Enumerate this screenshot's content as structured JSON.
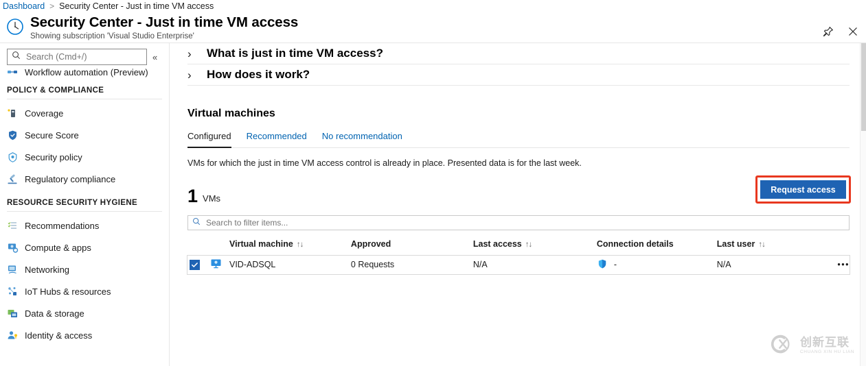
{
  "breadcrumb": {
    "root": "Dashboard",
    "separator": ">",
    "current": "Security Center - Just in time VM access"
  },
  "titlebar": {
    "icon": "clock-icon",
    "title": "Security Center - Just in time VM access",
    "subtitle": "Showing subscription 'Visual Studio Enterprise'",
    "pin_icon": "pin-icon",
    "close_icon": "close-icon"
  },
  "sidebar": {
    "search": {
      "placeholder": "Search (Cmd+/)",
      "value": "",
      "icon": "search-icon"
    },
    "collapse_icon": "chevron-double-left-icon",
    "clipped_item": {
      "label": "Workflow automation (Preview)",
      "icon": "workflow-icon"
    },
    "sections": [
      {
        "title": "POLICY & COMPLIANCE",
        "items": [
          {
            "label": "Coverage",
            "icon": "coverage-icon"
          },
          {
            "label": "Secure Score",
            "icon": "shield-icon"
          },
          {
            "label": "Security policy",
            "icon": "policy-icon"
          },
          {
            "label": "Regulatory compliance",
            "icon": "gavel-icon"
          }
        ]
      },
      {
        "title": "RESOURCE SECURITY HYGIENE",
        "items": [
          {
            "label": "Recommendations",
            "icon": "list-icon"
          },
          {
            "label": "Compute & apps",
            "icon": "compute-icon"
          },
          {
            "label": "Networking",
            "icon": "network-icon"
          },
          {
            "label": "IoT Hubs & resources",
            "icon": "iot-icon"
          },
          {
            "label": "Data & storage",
            "icon": "database-icon"
          },
          {
            "label": "Identity & access",
            "icon": "identity-icon"
          }
        ]
      }
    ]
  },
  "main": {
    "accordions": [
      {
        "label": "What is just in time VM access?",
        "icon": "chevron-right-icon"
      },
      {
        "label": "How does it work?",
        "icon": "chevron-right-icon"
      }
    ],
    "section_title": "Virtual machines",
    "tabs": [
      {
        "label": "Configured",
        "active": true
      },
      {
        "label": "Recommended",
        "active": false
      },
      {
        "label": "No recommendation",
        "active": false
      }
    ],
    "description": "VMs for which the just in time VM access control is already in place. Presented data is for the last week.",
    "count": {
      "number": "1",
      "label": "VMs"
    },
    "request_button": {
      "label": "Request access",
      "highlight_color": "#e8381f",
      "background": "#1f63b3"
    },
    "filter": {
      "placeholder": "Search to filter items...",
      "value": "",
      "icon": "search-icon"
    },
    "table": {
      "columns": [
        {
          "label": "Virtual machine",
          "sortable": true,
          "sort_icon": "↑↓"
        },
        {
          "label": "Approved",
          "sortable": false,
          "sort_icon": ""
        },
        {
          "label": "Last access",
          "sortable": true,
          "sort_icon": "↑↓"
        },
        {
          "label": "Connection details",
          "sortable": false,
          "sort_icon": ""
        },
        {
          "label": "Last user",
          "sortable": true,
          "sort_icon": "↑↓"
        }
      ],
      "rows": [
        {
          "selected": true,
          "checkbox_icon": "checkmark-icon",
          "vm_icon": "virtual-machine-icon",
          "virtual_machine": "VID-ADSQL",
          "approved": "0 Requests",
          "last_access": "N/A",
          "connection_icon": "shield-icon",
          "connection_details": "-",
          "last_user": "N/A",
          "menu_icon": "ellipsis-icon",
          "menu_label": "•••"
        }
      ]
    }
  },
  "watermark": {
    "chinese": "创新互联",
    "pinyin": "CHUANG XIN HU LIAN",
    "logo": "cx-logo-icon"
  }
}
